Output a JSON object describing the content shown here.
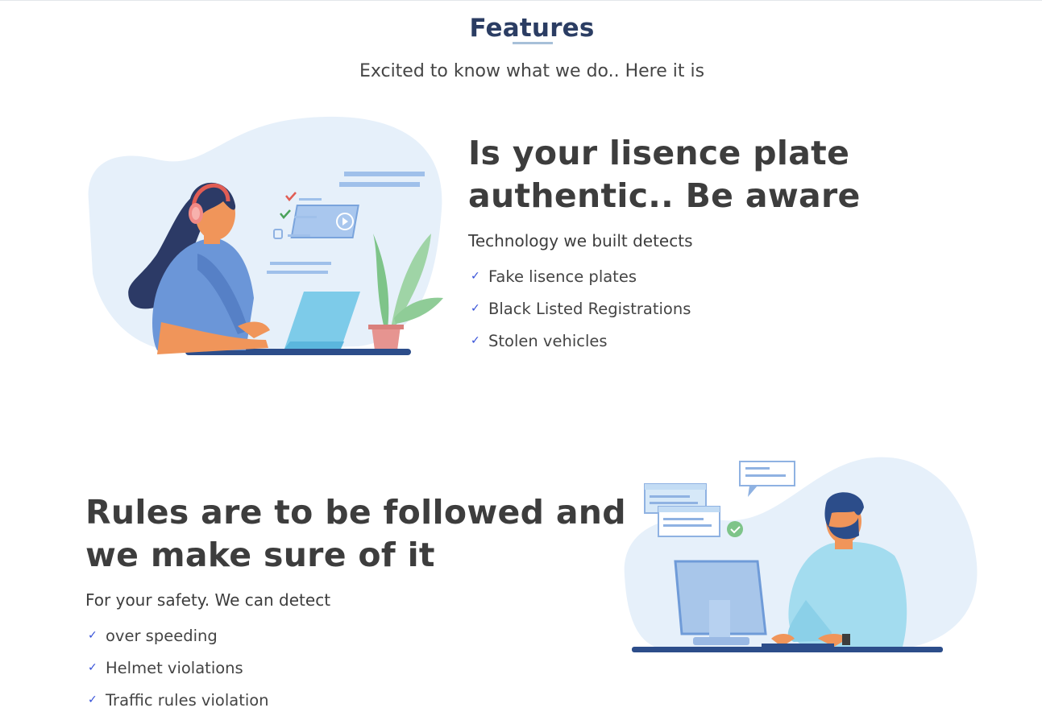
{
  "header": {
    "title": "Features",
    "subtitle": "Excited to know what we do.. Here it is"
  },
  "features": [
    {
      "heading_line1": "Is your lisence plate",
      "heading_line2": "authentic.. Be aware",
      "subheading": "Technology we built detects",
      "items": [
        " Fake lisence plates",
        "Black Listed Registrations",
        "Stolen vehicles"
      ],
      "illustration": "woman-with-headphones-at-laptop-illustration"
    },
    {
      "heading_line1": "Rules are to be followed and",
      "heading_line2": "we make sure of it",
      "subheading": "For your safety. We can detect",
      "items": [
        " over speeding",
        "Helmet violations",
        "Traffic rules violation"
      ],
      "illustration": "man-at-computer-illustration"
    }
  ],
  "icons": {
    "check": "check-icon"
  },
  "colors": {
    "title": "#2b3d63",
    "check": "#3550d8",
    "text": "#3d3d3d",
    "illustration_bg": "#e6f0fa"
  }
}
